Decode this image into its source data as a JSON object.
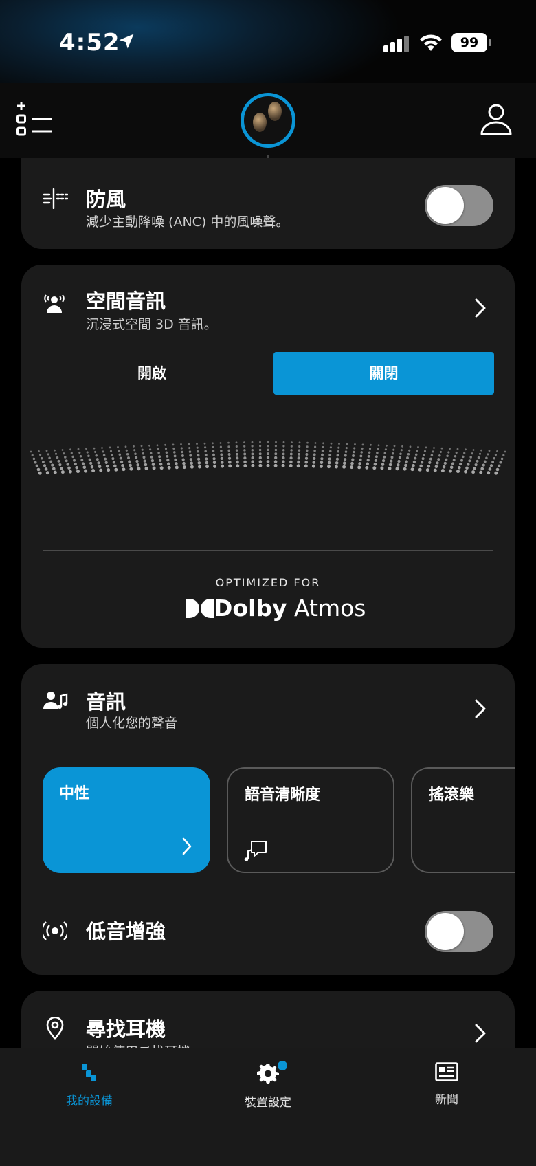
{
  "status_bar": {
    "time": "4:52",
    "battery": "99"
  },
  "header": {
    "menu_icon": "list-add-icon",
    "profile_icon": "profile-icon"
  },
  "cards": {
    "wind": {
      "title": "防風",
      "subtitle": "減少主動降噪 (ANC) 中的風噪聲。",
      "toggle_on": false
    },
    "spatial": {
      "title": "空間音訊",
      "subtitle": "沉浸式空間 3D 音訊。",
      "option_on": "開啟",
      "option_off": "關閉",
      "selected": "關閉",
      "optimized_for": "OPTIMIZED FOR",
      "dolby_brand_bold": "Dolby",
      "dolby_brand_light": " Atmos"
    },
    "audio": {
      "title": "音訊",
      "subtitle": "個人化您的聲音",
      "presets": [
        {
          "label": "中性",
          "active": true
        },
        {
          "label": "語音清晰度",
          "active": false
        },
        {
          "label": "搖滾樂",
          "active": false
        }
      ],
      "bass_title": "低音增強",
      "bass_toggle_on": false
    },
    "find": {
      "title": "尋找耳機",
      "subtitle": "開始使用尋找耳機"
    }
  },
  "bottom_nav": {
    "items": [
      {
        "label": "我的設備",
        "icon": "devices-icon",
        "active": true
      },
      {
        "label": "裝置設定",
        "icon": "gear-icon",
        "active": false,
        "badge": true
      },
      {
        "label": "新聞",
        "icon": "news-icon",
        "active": false
      }
    ]
  },
  "colors": {
    "accent": "#0a95d6",
    "card": "#1b1b1b",
    "background": "#000000"
  }
}
